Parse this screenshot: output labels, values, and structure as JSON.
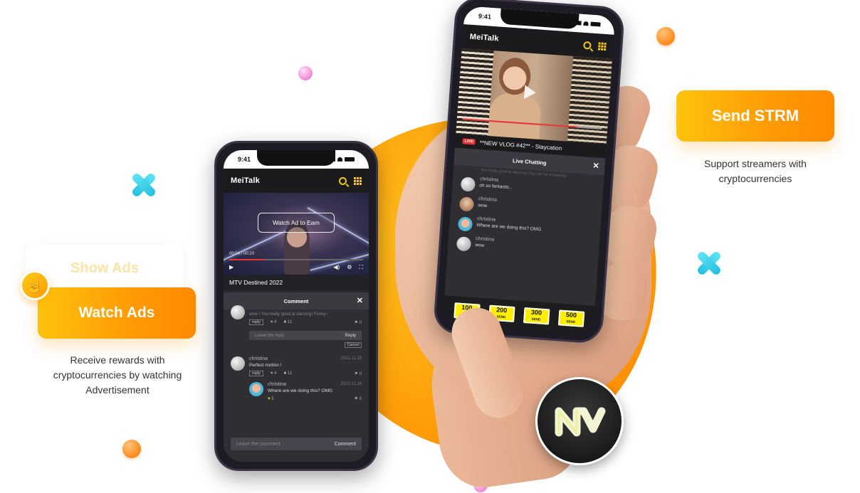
{
  "brand": {
    "app_name": "MeiTalk",
    "accent": "#f5c518",
    "orange": "#ff9a05"
  },
  "left_phone": {
    "time": "9:41",
    "app_title": "MeiTalk",
    "watch_ad_label": "Watch Ad to Earn",
    "video_time": "00:04 / 00:20",
    "video_title": "MTV Destined 2022",
    "comment_sheet_title": "Comment",
    "first_comment_text": "wow ! You really good at dancing! Funny~",
    "first_comment_likes": "4",
    "first_comment_replies": "11",
    "first_comment_flags": "0",
    "reply_tag": "reply",
    "reply_placeholder": "Leave the reply",
    "reply_button": "Reply",
    "cancel_button": "Cancel",
    "comments": [
      {
        "name": "christina",
        "date": "2021.11.15",
        "text": "Perfect motion !",
        "likes": "4",
        "replies": "11",
        "flags": "0"
      },
      {
        "name": "christina",
        "date": "2021.11.16",
        "text": "Where are we doing this? OMG",
        "likes": "5",
        "flags": "0"
      }
    ],
    "comment_placeholder": "Leave the comment",
    "comment_button": "Comment"
  },
  "right_phone": {
    "time": "9:41",
    "app_title": "MeiTalk",
    "live_badge": "LIVE",
    "stream_title": "**NEW VLOG #42** - Staycation",
    "chat_title": "Live Chatting",
    "faded_message": "You really good at dancing! You can be a dancing",
    "chats": [
      {
        "name": "christina",
        "text": "oh so fantastic.."
      },
      {
        "name": "christina",
        "text": "wow"
      },
      {
        "name": "christina",
        "text": "Where are we doing this? OMG"
      },
      {
        "name": "christina",
        "text": "wow"
      }
    ],
    "send_buttons": [
      {
        "amount": "100",
        "label": "SEND"
      },
      {
        "amount": "200",
        "label": "SEND"
      },
      {
        "amount": "300",
        "label": "SEND"
      },
      {
        "amount": "500",
        "label": "SEND"
      }
    ]
  },
  "left_feature": {
    "ghost_label": "Show Ads",
    "button_label": "Watch Ads",
    "description": "Receive rewards with cryptocurrencies by watching Advertisement"
  },
  "right_feature": {
    "button_label": "Send STRM",
    "description": "Support streamers with cryptocurrencies"
  },
  "logo_text": "NV"
}
